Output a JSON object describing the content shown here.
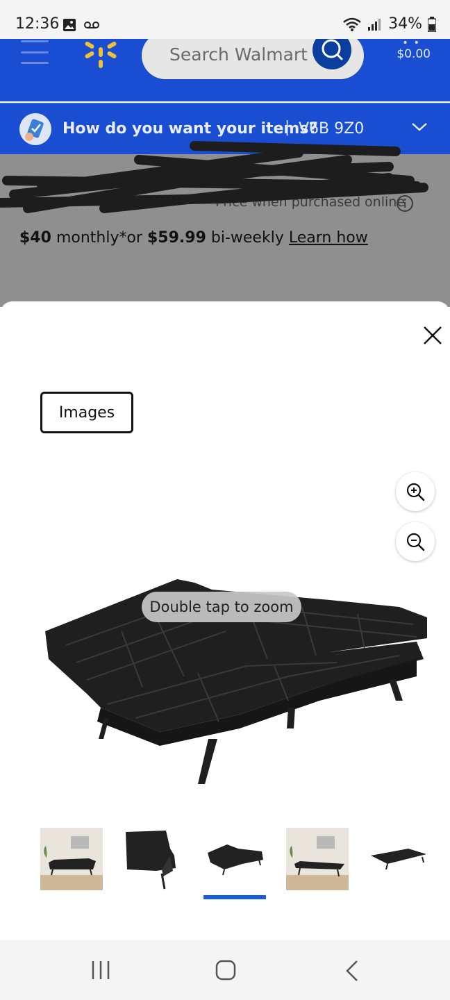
{
  "status_bar": {
    "time": "12:36",
    "battery": "34%",
    "icons": [
      "image-icon",
      "voicemail-icon",
      "wifi-icon",
      "signal-icon",
      "battery-icon"
    ]
  },
  "header": {
    "search_placeholder": "Search Walmart",
    "cart_total": "$0.00",
    "brand_color": "#1a4ed2"
  },
  "delivery_bar": {
    "question": "How do you want your items?",
    "separator": "|",
    "postal_code": "V6B 9Z0"
  },
  "product": {
    "price_note": "Price when purchased online",
    "monthly": "$40",
    "monthly_label": "monthly*or",
    "biweekly": "$59.99",
    "biweekly_label": "bi-weekly",
    "learn_link": "Learn how"
  },
  "image_viewer": {
    "tab_label": "Images",
    "toast": "Double tap to zoom",
    "selected_thumbnail": 3,
    "thumbnail_count": 5,
    "accent_color": "#1560d8"
  }
}
